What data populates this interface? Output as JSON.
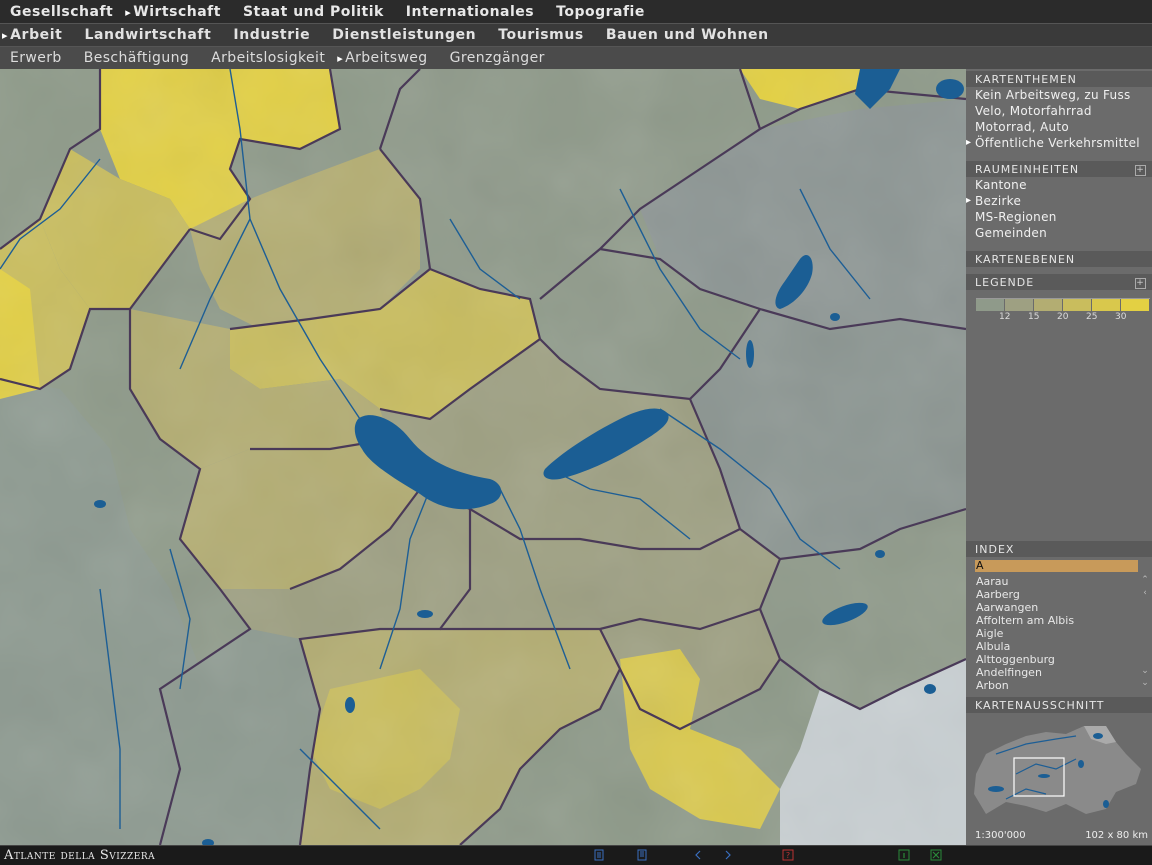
{
  "topnav": [
    {
      "label": "Gesellschaft",
      "active": false
    },
    {
      "label": "Wirtschaft",
      "active": true
    },
    {
      "label": "Staat und Politik",
      "active": false
    },
    {
      "label": "Internationales",
      "active": false
    },
    {
      "label": "Topografie",
      "active": false
    }
  ],
  "subnav": [
    {
      "label": "Arbeit",
      "active": true
    },
    {
      "label": "Landwirtschaft",
      "active": false
    },
    {
      "label": "Industrie",
      "active": false
    },
    {
      "label": "Dienstleistungen",
      "active": false
    },
    {
      "label": "Tourismus",
      "active": false
    },
    {
      "label": "Bauen und Wohnen",
      "active": false
    }
  ],
  "subsubnav": [
    {
      "label": "Erwerb",
      "active": false
    },
    {
      "label": "Beschäftigung",
      "active": false
    },
    {
      "label": "Arbeitslosigkeit",
      "active": false
    },
    {
      "label": "Arbeitsweg",
      "active": true
    },
    {
      "label": "Grenzgänger",
      "active": false
    }
  ],
  "sidebar": {
    "kartenthemen": {
      "title": "KARTENTHEMEN",
      "items": [
        {
          "label": "Kein Arbeitsweg, zu Fuss",
          "active": false
        },
        {
          "label": "Velo, Motorfahrrad",
          "active": false
        },
        {
          "label": "Motorrad, Auto",
          "active": false
        },
        {
          "label": "Öffentliche Verkehrsmittel",
          "active": true
        }
      ]
    },
    "raumeinheiten": {
      "title": "RAUMEINHEITEN",
      "items": [
        {
          "label": "Kantone",
          "active": false
        },
        {
          "label": "Bezirke",
          "active": true
        },
        {
          "label": "MS-Regionen",
          "active": false
        },
        {
          "label": "Gemeinden",
          "active": false
        }
      ]
    },
    "kartenebenen": {
      "title": "KARTENEBENEN"
    },
    "legende": {
      "title": "LEGENDE",
      "colors": [
        "#8f9a8a",
        "#9ea082",
        "#b3ad72",
        "#c9bd5d",
        "#d9c84c",
        "#e3d043"
      ],
      "labels": [
        "12",
        "15",
        "20",
        "25",
        "30"
      ]
    },
    "index": {
      "title": "INDEX",
      "input_value": "A",
      "items": [
        "Aarau",
        "Aarberg",
        "Aarwangen",
        "Affoltern am Albis",
        "Aigle",
        "Albula",
        "Alttoggenburg",
        "Andelfingen",
        "Arbon"
      ]
    },
    "kartenausschnitt": {
      "title": "KARTENAUSSCHNITT",
      "scale": "1:300'000",
      "extent": "102 x 80 km"
    }
  },
  "footer": {
    "brand": "Atlante della Svizzera"
  },
  "colors": {
    "lake": "#1b5e94",
    "border": "#4a3a58",
    "river": "#1d5e95",
    "accent": "#c89a5a"
  }
}
